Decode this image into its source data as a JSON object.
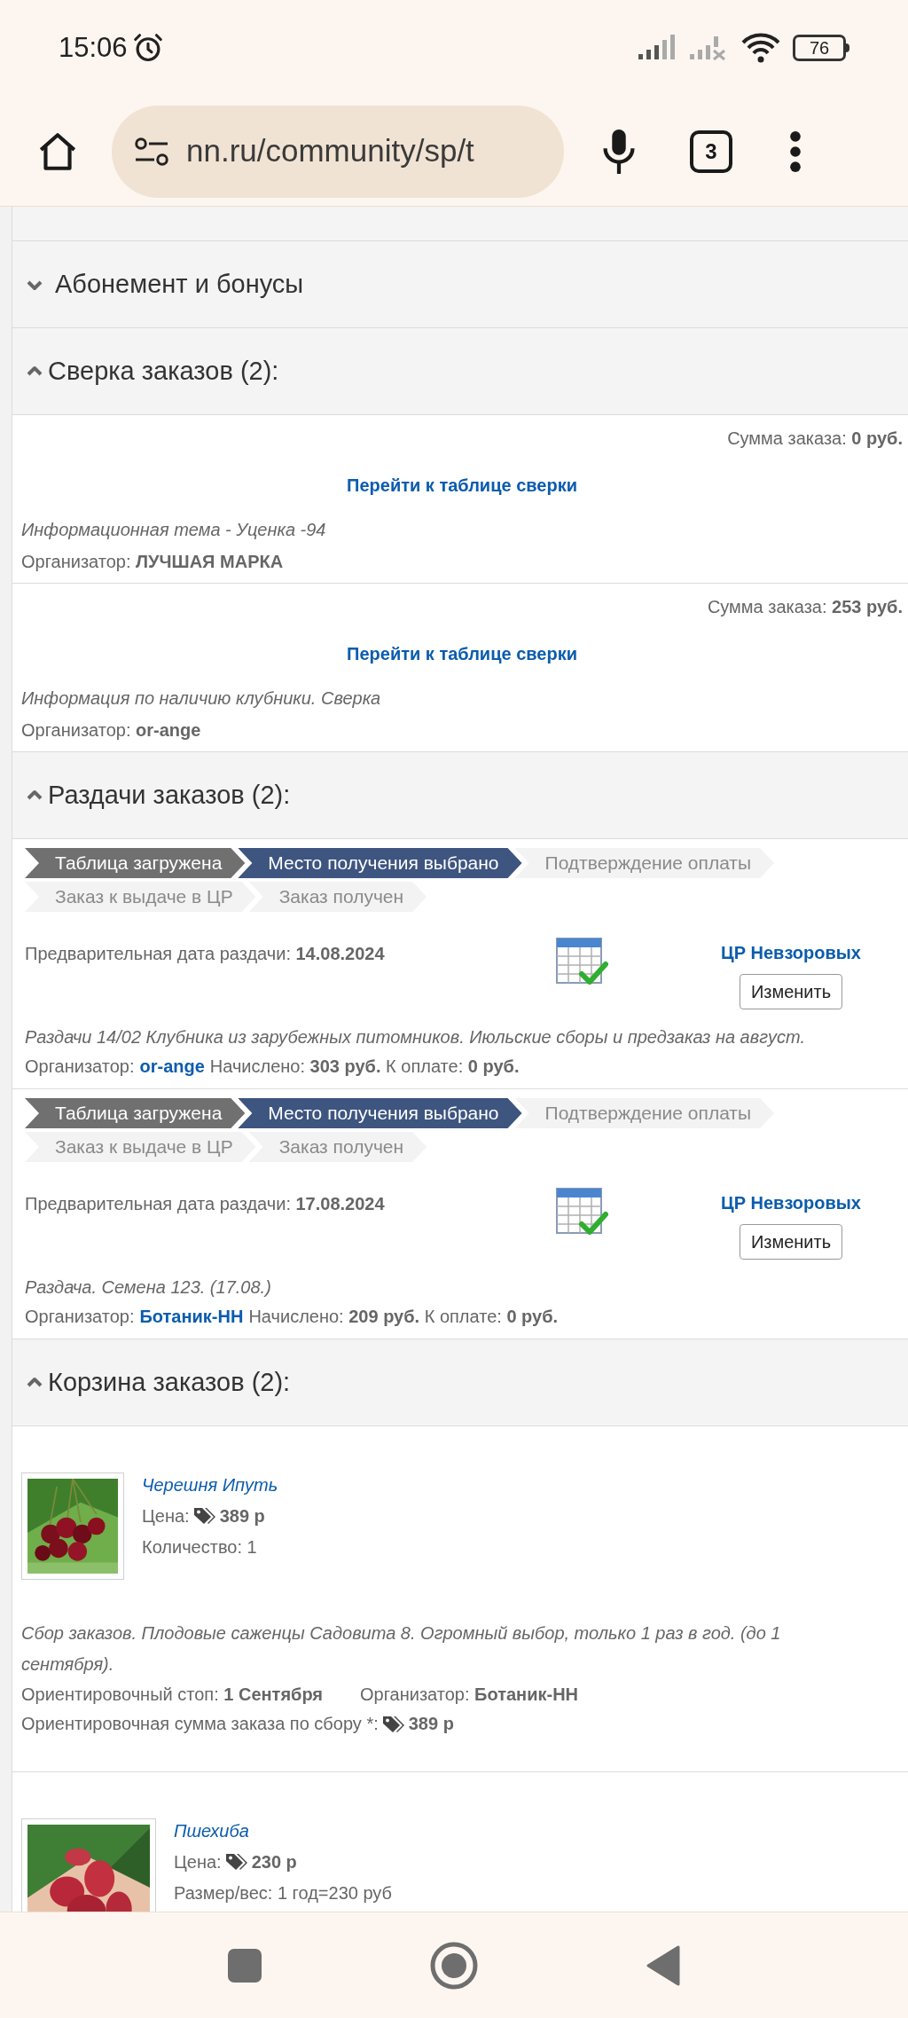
{
  "status_bar": {
    "time": "15:06",
    "battery": "76"
  },
  "browser": {
    "url": "nn.ru/community/sp/t",
    "tab_count": "3"
  },
  "sections": [
    {
      "title": "Абонемент и бонусы",
      "expanded": false
    },
    {
      "kind": "reconciliation",
      "title": "Сверка заказов (2):",
      "expanded": true,
      "items": [
        {
          "sum": "Сумма заказа: **0 руб.**",
          "link": "Перейти к таблице сверки",
          "topic": "Информационная тема - Уценка -94",
          "organizer": "Организатор: **ЛУЧШАЯ МАРКА**"
        },
        {
          "sum": "Сумма заказа: **253 руб.**",
          "link": "Перейти к таблице сверки",
          "topic": "Информация по наличию клубники. Сверка",
          "organizer": "Организатор: **or-ange**"
        }
      ]
    },
    {
      "kind": "distribution",
      "title": "Раздачи заказов (2):",
      "expanded": true,
      "items": [
        {
          "steps": [
            {
              "label": "Таблица загружена",
              "done": true,
              "current": false
            },
            {
              "label": "Место получения выбрано",
              "done": false,
              "current": true
            },
            {
              "label": "Подтверждение оплаты",
              "done": false,
              "current": false
            },
            {
              "label": "Заказ к выдаче в ЦР",
              "done": false,
              "current": false
            },
            {
              "label": "Заказ получен",
              "done": false,
              "current": false
            }
          ],
          "date": "Предварительная дата раздачи: **14.08.2024**",
          "pickup_point": "ЦР Невзоровых",
          "change_button": "Изменить",
          "topic": "Раздачи 14/02 Клубника из зарубежных питомников. Июльские сборы и предзаказ на август.",
          "organizer_label": "Организатор:",
          "organizer": "or-ange",
          "totals": "Начислено: **303 руб.** К оплате: **0 руб.**"
        },
        {
          "steps": [
            {
              "label": "Таблица загружена",
              "done": true,
              "current": false
            },
            {
              "label": "Место получения выбрано",
              "done": false,
              "current": true
            },
            {
              "label": "Подтверждение оплаты",
              "done": false,
              "current": false
            },
            {
              "label": "Заказ к выдаче в ЦР",
              "done": false,
              "current": false
            },
            {
              "label": "Заказ получен",
              "done": false,
              "current": false
            }
          ],
          "date": "Предварительная дата раздачи: **17.08.2024**",
          "pickup_point": "ЦР Невзоровых",
          "change_button": "Изменить",
          "topic": "Раздача. Семена 123. (17.08.)",
          "organizer_label": "Организатор:",
          "organizer": "Ботаник-НН",
          "totals": "Начислено: **209 руб.** К оплате: **0 руб.**"
        }
      ]
    },
    {
      "kind": "cart",
      "title": "Корзина заказов (2):",
      "expanded": true,
      "items": [
        {
          "kind": "picture",
          "name": "Черешня Ипуть",
          "price_label": "Цена:",
          "price": "389 р",
          "details": [
            "Количество: 1"
          ],
          "topic": "Сбор заказов. Плодовые саженцы Садовита 8. Огромный выбор, только 1 раз в год. (до 1 сентября).",
          "stop": "Ориентировочный стоп: **1 Сентября**",
          "organizer": "Организатор: **Ботаник-НН**",
          "total_label": "Ориентировочная сумма заказа по сбору *:",
          "total": "389 р"
        },
        {
          "kind": "picture",
          "name": "Пшехиба",
          "price_label": "Цена:",
          "price": "230 р",
          "details": [
            "Размер/вес: 1 год=230 руб"
          ]
        }
      ]
    }
  ]
}
